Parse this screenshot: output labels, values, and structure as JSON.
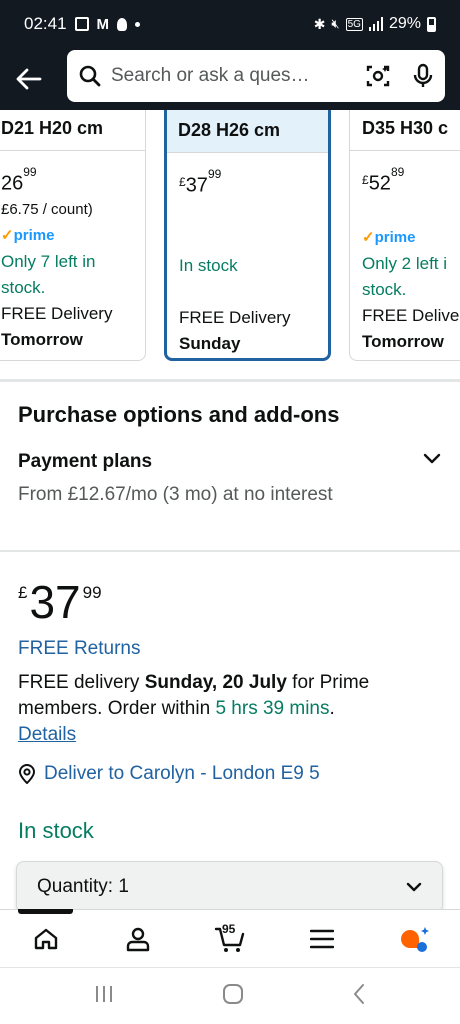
{
  "status_bar": {
    "time": "02:41",
    "battery": "29%",
    "network": "5G"
  },
  "search": {
    "placeholder": "Search or ask a ques…"
  },
  "size_options": [
    {
      "label": "D21 H20 cm",
      "price_whole": "26",
      "price_fraction": "99",
      "unit_price": "£6.75 / count)",
      "prime": "prime",
      "stock": "Only 7 left in",
      "stock2": "stock.",
      "delivery": "FREE Delivery",
      "delivery_day": "Tomorrow"
    },
    {
      "label": "D28 H26 cm",
      "currency": "£",
      "price_whole": "37",
      "price_fraction": "99",
      "stock": "In stock",
      "delivery": "FREE Delivery",
      "delivery_day": "Sunday"
    },
    {
      "label": "D35 H30 c",
      "currency": "£",
      "price_whole": "52",
      "price_fraction": "89",
      "prime": "prime",
      "stock": "Only 2 left i",
      "stock2": "stock.",
      "delivery": "FREE Delive",
      "delivery_day": "Tomorrow"
    }
  ],
  "purchase_options": {
    "title": "Purchase options and add-ons",
    "payment_plans_title": "Payment plans",
    "payment_plans_desc": "From £12.67/mo (3 mo) at no interest"
  },
  "price": {
    "currency": "£",
    "whole": "37",
    "fraction": "99"
  },
  "free_returns": "FREE Returns",
  "delivery": {
    "prefix": "FREE delivery ",
    "date": "Sunday, 20 July",
    "middle": " for Prime members. Order within ",
    "countdown": "5 hrs 39 mins",
    "suffix": ". ",
    "details_link": "Details"
  },
  "deliver_to": "Deliver to Carolyn - London E9 5",
  "in_stock": "In stock",
  "quantity": {
    "label": "Quantity: 1"
  },
  "bottom_nav": {
    "cart_count": "95"
  },
  "colors": {
    "header_bg": "#131921",
    "link": "#2162a1",
    "in_stock_green": "#067d62",
    "selected_border": "#2162a1",
    "prime_blue": "#1a98ff",
    "rufus_orange": "#ff6200"
  }
}
